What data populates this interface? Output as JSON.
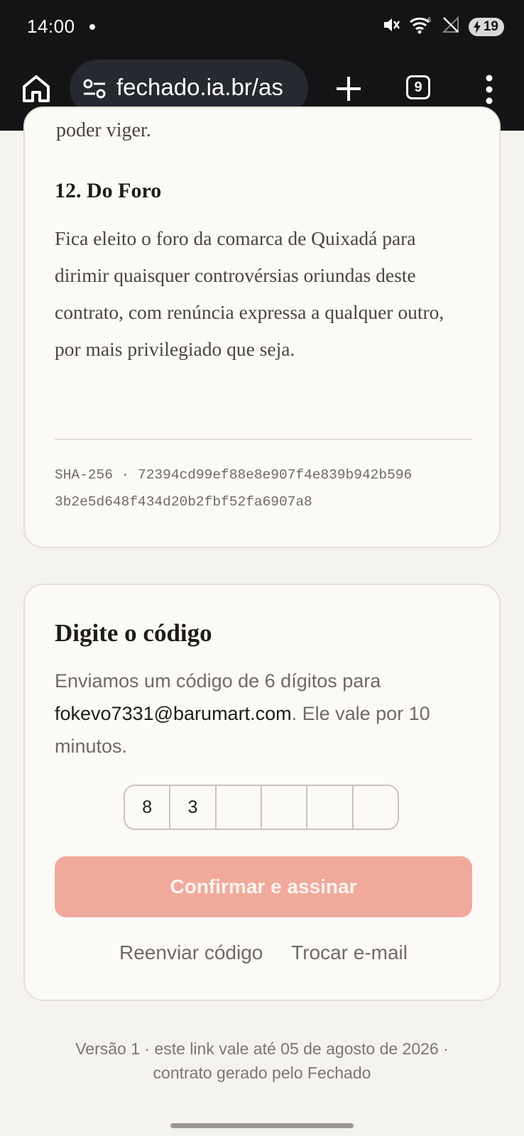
{
  "status_bar": {
    "time": "14:00",
    "battery_level": "19",
    "icons": [
      "mute-icon",
      "wifi-icon",
      "no-signal-icon",
      "battery-charging-icon"
    ]
  },
  "browser": {
    "url": "fechado.ia.br/as",
    "tab_count": "9",
    "icons": [
      "home-icon",
      "site-settings-icon",
      "new-tab-icon",
      "tabs-icon",
      "overflow-menu-icon"
    ]
  },
  "contract": {
    "clipped_text": "poder viger.",
    "clause_title": "12. Do Foro",
    "clause_body": "Fica eleito o foro da comarca de Quixadá para dirimir quaisquer controvérsias oriundas deste contrato, com renúncia expressa a qualquer outro, por mais privilegiado que seja.",
    "hash_line1": "SHA-256 · 72394cd99ef88e8e907f4e839b942b596",
    "hash_line2": "3b2e5d648f434d20b2fbf52fa6907a8"
  },
  "verification": {
    "title": "Digite o código",
    "desc_before": "Enviamos um código de 6 dígitos para ",
    "email": "fokevo7331@barumart.com",
    "desc_after": ". Ele vale por 10 minutos.",
    "otp": [
      "8",
      "3",
      "",
      "",
      "",
      ""
    ],
    "confirm_label": "Confirmar e assinar",
    "resend_label": "Reenviar código",
    "change_email_label": "Trocar e-mail"
  },
  "footer": {
    "line1": "Versão 1 · este link vale até 05 de agosto de 2026 ·",
    "line2": "contrato gerado pelo Fechado"
  }
}
